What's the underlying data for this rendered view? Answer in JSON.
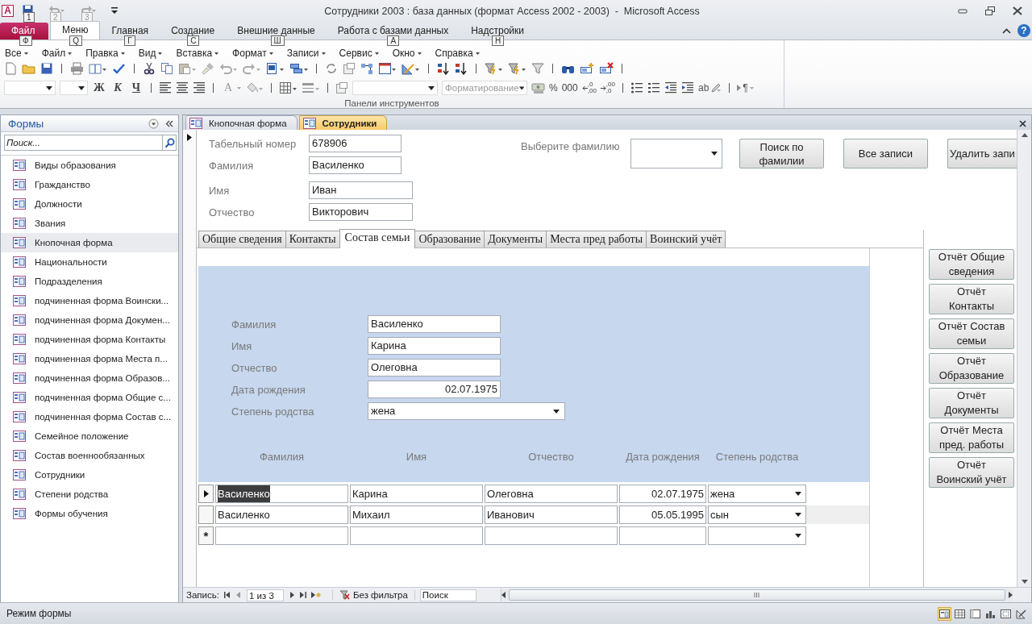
{
  "window": {
    "title": "Сотрудники 2003 : база данных (формат Access 2002 - 2003)  -  Microsoft Access",
    "app_logo": "A"
  },
  "quick_access": [
    {
      "kind": "save",
      "key_tip": "1",
      "disabled": false
    },
    {
      "kind": "undo",
      "key_tip": "2",
      "disabled": true
    },
    {
      "kind": "redo",
      "key_tip": "3",
      "disabled": true
    }
  ],
  "help": "?",
  "ribbon_tabs": [
    {
      "label": "Файл",
      "key_tip": "Ф",
      "kind": "file",
      "selected": false
    },
    {
      "label": "Меню",
      "key_tip": "Q",
      "kind": "tab",
      "selected": true
    },
    {
      "label": "Главная",
      "key_tip": "Г",
      "kind": "tab",
      "selected": false
    },
    {
      "label": "Создание",
      "key_tip": "С",
      "kind": "tab",
      "selected": false
    },
    {
      "label": "Внешние данные",
      "key_tip": "Ш",
      "kind": "tab",
      "selected": false
    },
    {
      "label": "Работа с базами данных",
      "key_tip": "А",
      "kind": "tab",
      "selected": false
    },
    {
      "label": "Надстройки",
      "key_tip": "Н",
      "kind": "tab",
      "selected": false
    }
  ],
  "menu_bar": [
    "Все",
    "Файл",
    "Правка",
    "Вид",
    "Вставка",
    "Формат",
    "Записи",
    "Сервис",
    "Окно",
    "Справка"
  ],
  "toolbar": {
    "format_buttons": [
      "Ж",
      "К",
      "Ч"
    ],
    "font_color_button": "A",
    "format_field": {
      "placeholder": "Форматирование"
    },
    "number_buttons": [
      "%",
      "000"
    ],
    "decimal_buttons": [
      {
        "top": ",0",
        "bottom": ",00"
      },
      {
        "top": ",00",
        "bottom": ",0"
      }
    ],
    "text_direction_button": "ab",
    "paragraph_button": "¶",
    "group_label": "Панели инструментов"
  },
  "navigation_pane": {
    "title": "Формы",
    "search": {
      "placeholder": "Поиск..."
    },
    "items": [
      {
        "label": "Виды образования",
        "selected": false
      },
      {
        "label": "Гражданство",
        "selected": false
      },
      {
        "label": "Должности",
        "selected": false
      },
      {
        "label": "Звания",
        "selected": false
      },
      {
        "label": "Кнопочная форма",
        "selected": true
      },
      {
        "label": "Национальности",
        "selected": false
      },
      {
        "label": "Подразделения",
        "selected": false
      },
      {
        "label": "подчиненная форма Воински...",
        "selected": false
      },
      {
        "label": "подчиненная форма Докумен...",
        "selected": false
      },
      {
        "label": "подчиненная форма Контакты",
        "selected": false
      },
      {
        "label": "подчиненная форма Места п...",
        "selected": false
      },
      {
        "label": "подчиненная форма Образов...",
        "selected": false
      },
      {
        "label": "подчиненная форма Общие с...",
        "selected": false
      },
      {
        "label": "подчиненная форма Состав с...",
        "selected": false
      },
      {
        "label": "Семейное положение",
        "selected": false
      },
      {
        "label": "Состав военнообязанных",
        "selected": false
      },
      {
        "label": "Сотрудники",
        "selected": false
      },
      {
        "label": "Степени родства",
        "selected": false
      },
      {
        "label": "Формы обучения",
        "selected": false
      }
    ]
  },
  "document_tabs": [
    {
      "label": "Кнопочная форма",
      "selected": false
    },
    {
      "label": "Сотрудники",
      "selected": true
    }
  ],
  "form": {
    "fields": [
      {
        "label": "Табельный номер",
        "value": "678906"
      },
      {
        "label": "Фамилия",
        "value": "Василенко"
      },
      {
        "label": "Имя",
        "value": "Иван"
      },
      {
        "label": "Отчество",
        "value": "Викторович"
      }
    ],
    "surname_picker": {
      "label": "Выберите фамилию"
    },
    "buttons": [
      "Поиск по\nфамилии",
      "Все записи",
      "Удалить запи"
    ],
    "tabs": [
      {
        "label": "Общие сведения",
        "selected": false
      },
      {
        "label": "Контакты",
        "selected": false
      },
      {
        "label": "Состав семьи",
        "selected": true
      },
      {
        "label": "Образование",
        "selected": false
      },
      {
        "label": "Документы",
        "selected": false
      },
      {
        "label": "Места пред работы",
        "selected": false
      },
      {
        "label": "Воинский учёт",
        "selected": false
      }
    ],
    "subform": {
      "fields": [
        {
          "label": "Фамилия",
          "value": "Василенко",
          "kind": "text"
        },
        {
          "label": "Имя",
          "value": "Карина",
          "kind": "text"
        },
        {
          "label": "Отчество",
          "value": "Олеговна",
          "kind": "text"
        },
        {
          "label": "Дата рождения",
          "value": "02.07.1975",
          "kind": "date"
        },
        {
          "label": "Степень родства",
          "value": "жена",
          "kind": "combo"
        }
      ],
      "columns": [
        {
          "label": "Фамилия",
          "kind": "text"
        },
        {
          "label": "Имя",
          "kind": "text"
        },
        {
          "label": "Отчество",
          "kind": "text"
        },
        {
          "label": "Дата рождения",
          "kind": "date"
        },
        {
          "label": "Степень родства",
          "kind": "combo"
        }
      ],
      "rows": [
        {
          "current": true,
          "cells": [
            {
              "text": "Василенко",
              "selected": true
            },
            {
              "text": "Карина",
              "selected": false
            },
            {
              "text": "Олеговна",
              "selected": false
            },
            {
              "text": "02.07.1975",
              "selected": false
            },
            {
              "text": "жена",
              "selected": false
            }
          ]
        },
        {
          "current": false,
          "cells": [
            {
              "text": "Василенко",
              "selected": false
            },
            {
              "text": "Михаил",
              "selected": false
            },
            {
              "text": "Иванович",
              "selected": false
            },
            {
              "text": "05.05.1995",
              "selected": false
            },
            {
              "text": "сын",
              "selected": false
            }
          ]
        }
      ],
      "new_row_marker": "*"
    },
    "report_buttons": [
      "Отчёт Общие\nсведения",
      "Отчёт\nКонтакты",
      "Отчёт Состав\nсемьи",
      "Отчёт\nОбразование",
      "Отчёт\nДокументы",
      "Отчёт Места\nпред. работы",
      "Отчёт\nВоинский учёт"
    ]
  },
  "record_navigator": {
    "label": "Запись:",
    "position": "1 из 3",
    "filter": "Без фильтра",
    "search": {
      "placeholder": "Поиск"
    }
  },
  "status_bar": {
    "text": "Режим формы"
  }
}
